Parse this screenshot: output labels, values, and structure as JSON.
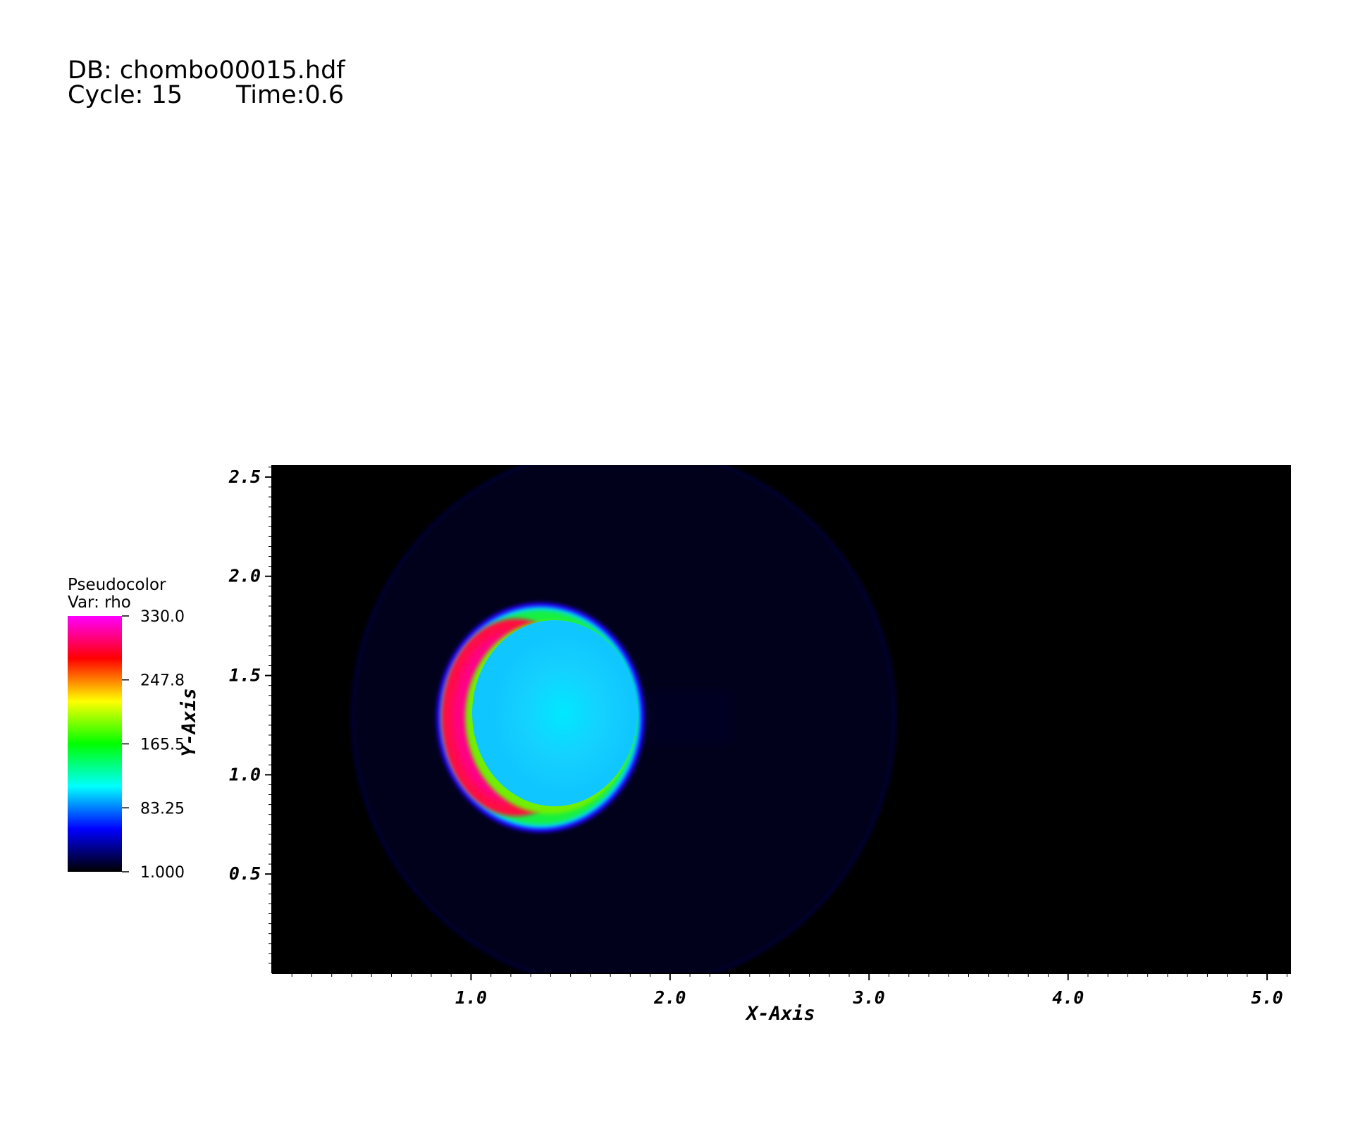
{
  "header": {
    "db_line": "DB: chombo00015.hdf",
    "cycle_line": "Cycle: 15",
    "time_line": "Time:0.6"
  },
  "legend": {
    "title": "Pseudocolor",
    "var": "Var: rho"
  },
  "colors": {
    "background": "#000000",
    "colormap": [
      "#000000",
      "#0000ff",
      "#00ffff",
      "#00ff00",
      "#ffff00",
      "#ff0000",
      "#ff00ff"
    ]
  },
  "chart_data": {
    "type": "heatmap",
    "title": "",
    "variable": "rho",
    "xlabel": "X-Axis",
    "ylabel": "Y-Axis",
    "xlim": [
      0.0,
      5.12
    ],
    "ylim": [
      0.0,
      2.56
    ],
    "x_ticks": [
      "1.0",
      "2.0",
      "3.0",
      "4.0",
      "5.0"
    ],
    "y_ticks": [
      "0.5",
      "1.0",
      "1.5",
      "2.0",
      "2.5"
    ],
    "colorbar": {
      "min": 1.0,
      "max": 330.0,
      "labels": [
        "330.0",
        "247.8",
        "165.5",
        "83.25",
        "1.000"
      ]
    },
    "features": [
      {
        "name": "bubble",
        "center": [
          1.38,
          1.28
        ],
        "radius": 0.52,
        "interior_rho": 95
      },
      {
        "name": "dense-crescent",
        "center_x": 1.0,
        "rho": 310
      },
      {
        "name": "outer-shock-arc",
        "center_x": 1.6,
        "radius": 1.3,
        "rho": 10
      }
    ]
  }
}
